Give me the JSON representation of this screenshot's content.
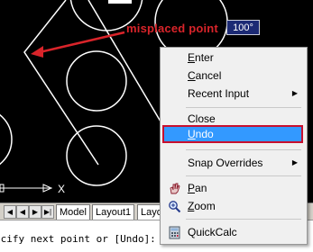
{
  "annotation": {
    "text": "misplaced point"
  },
  "dynamic_input": {
    "value": "100°"
  },
  "context_menu": {
    "items": [
      {
        "label": "Enter",
        "mnemonic": "E",
        "rest": "nter",
        "submenu": false
      },
      {
        "label": "Cancel",
        "mnemonic": "C",
        "rest": "ancel",
        "submenu": false
      },
      {
        "label": "Recent Input",
        "submenu": true
      },
      {
        "label": "Close",
        "submenu": false
      },
      {
        "label": "Undo",
        "mnemonic": "U",
        "rest": "ndo",
        "submenu": false,
        "highlighted": true
      },
      {
        "label": "Snap Overrides",
        "submenu": true
      },
      {
        "label": "Pan",
        "mnemonic": "P",
        "rest": "an",
        "icon": "pan-hand-icon"
      },
      {
        "label": "Zoom",
        "mnemonic": "Z",
        "rest": "oom",
        "icon": "zoom-magnifier-icon"
      },
      {
        "label": "QuickCalc",
        "icon": "calculator-icon"
      }
    ]
  },
  "tabs": {
    "nav_buttons": [
      "◀",
      "▶",
      "▶|"
    ],
    "model": "Model",
    "layout1": "Layout1",
    "layout2": "Layou"
  },
  "command_line": {
    "text": "ecify next point or [Undo]:"
  },
  "ucs_icon": {
    "x_label": "X"
  },
  "colors": {
    "canvas": "#000000",
    "annotation": "#d9242a",
    "highlight": "#3399ff",
    "highlight_border": "#c8102e",
    "tooltip": "#1c2a74"
  }
}
